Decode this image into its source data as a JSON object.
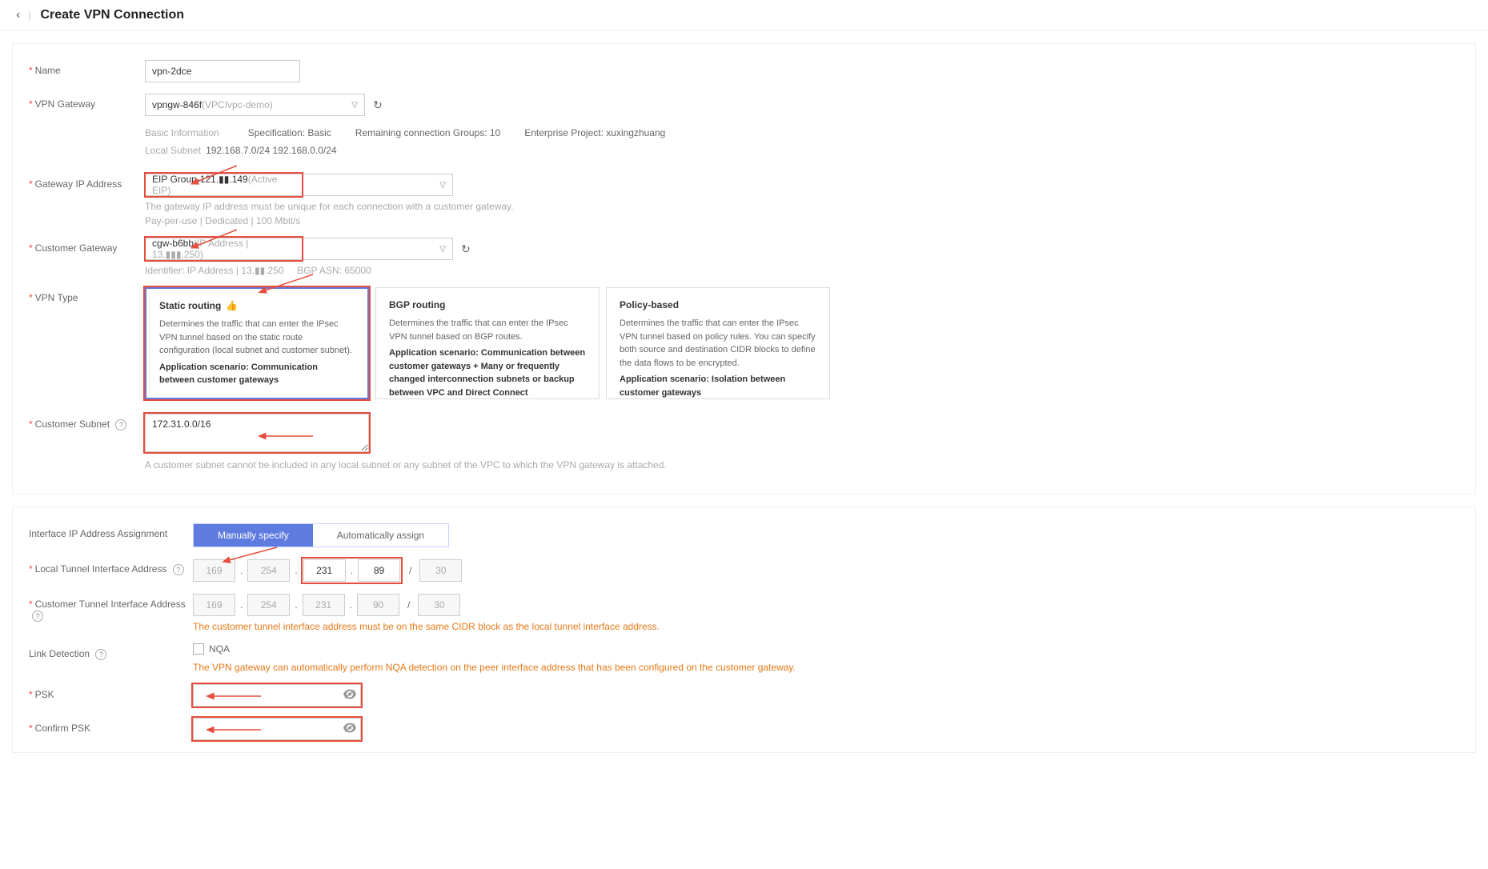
{
  "header": {
    "title": "Create VPN Connection"
  },
  "labels": {
    "name": "Name",
    "vpn_gateway": "VPN Gateway",
    "gateway_ip": "Gateway IP Address",
    "customer_gateway": "Customer Gateway",
    "vpn_type": "VPN Type",
    "customer_subnet": "Customer Subnet",
    "iface_assign": "Interface IP Address Assignment",
    "local_tunnel": "Local Tunnel Interface Address",
    "customer_tunnel": "Customer Tunnel Interface Address",
    "link_detection": "Link Detection",
    "psk": "PSK",
    "confirm_psk": "Confirm PSK"
  },
  "name_value": "vpn-2dce",
  "vpn_gateway": {
    "value_main": "vpngw-846f",
    "value_sub": "(VPCIvpc-demo)",
    "basic_info": "Basic Information",
    "spec": "Specification: Basic",
    "remaining": "Remaining connection Groups: 10",
    "enterprise": "Enterprise Project: xuxingzhuang",
    "local_subnet_label": "Local Subnet",
    "local_subnet_value": "192.168.7.0/24 192.168.0.0/24"
  },
  "gateway_ip": {
    "value_main": "EIP Group-121.▮▮.149",
    "value_sub": "(Active EIP)",
    "hint": "The gateway IP address must be unique for each connection with a customer gateway.",
    "pay": "Pay-per-use | Dedicated | 100 Mbit/s"
  },
  "customer_gateway": {
    "value_main": "cgw-b6bb",
    "value_sub": "(IP Address | 13.▮▮▮.250)",
    "identifier": "Identifier: IP Address | 13.▮▮.250",
    "bgp": "BGP ASN: 65000"
  },
  "vpn_types": [
    {
      "title": "Static routing",
      "recommended": true,
      "desc": "Determines the traffic that can enter the IPsec VPN tunnel based on the static route configuration (local subnet and customer subnet).",
      "scenario": "Application scenario: Communication between customer gateways"
    },
    {
      "title": "BGP routing",
      "recommended": false,
      "desc": "Determines the traffic that can enter the IPsec VPN tunnel based on BGP routes.",
      "scenario": "Application scenario: Communication between customer gateways + Many or frequently changed interconnection subnets or backup between VPC and Direct Connect"
    },
    {
      "title": "Policy-based",
      "recommended": false,
      "desc": "Determines the traffic that can enter the IPsec VPN tunnel based on policy rules. You can specify both source and destination CIDR blocks to define the data flows to be encrypted.",
      "scenario": "Application scenario: Isolation between customer gateways"
    }
  ],
  "customer_subnet": {
    "value": "172.31.0.0/16",
    "hint": "A customer subnet cannot be included in any local subnet or any subnet of the VPC to which the VPN gateway is attached."
  },
  "iface_assign": {
    "manual": "Manually specify",
    "auto": "Automatically assign"
  },
  "local_tunnel": {
    "o1": "169",
    "o2": "254",
    "o3": "231",
    "o4": "89",
    "mask": "30"
  },
  "customer_tunnel": {
    "o1": "169",
    "o2": "254",
    "o3": "231",
    "o4": "90",
    "mask": "30",
    "warn": "The customer tunnel interface address must be on the same CIDR block as the local tunnel interface address."
  },
  "link_detection": {
    "nqa": "NQA",
    "warn": "The VPN gateway can automatically perform NQA detection on the peer interface address that has been configured on the customer gateway."
  }
}
